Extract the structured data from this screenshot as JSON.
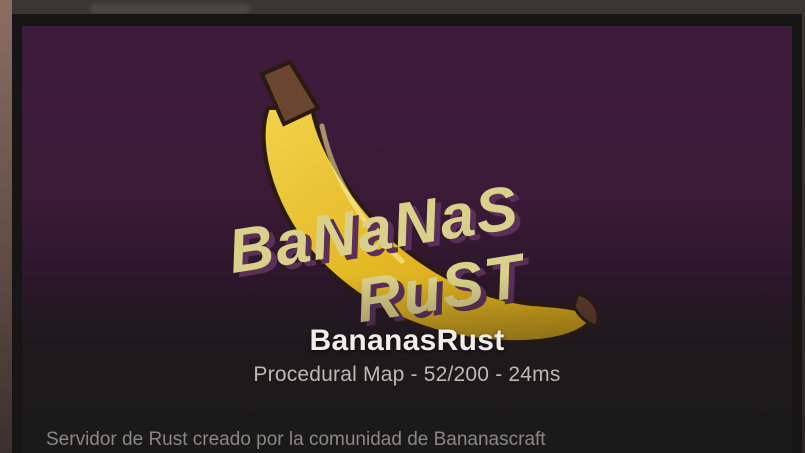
{
  "server": {
    "name": "BananasRust",
    "info": "Procedural Map - 52/200 - 24ms",
    "description": "Servidor de Rust creado por la comunidad de Bananascraft",
    "logo_text": {
      "line1": "BaNaNaS",
      "line2": "RuST"
    }
  },
  "colors": {
    "header_purple": "#3f1b3d",
    "logo_text_yellow": "#d9d08a",
    "banana_yellow": "#e9c329",
    "banana_stem": "#5a3a2a",
    "title_text": "#f1eeea",
    "info_text": "#bdb8b3",
    "description_text": "#8b8783"
  }
}
